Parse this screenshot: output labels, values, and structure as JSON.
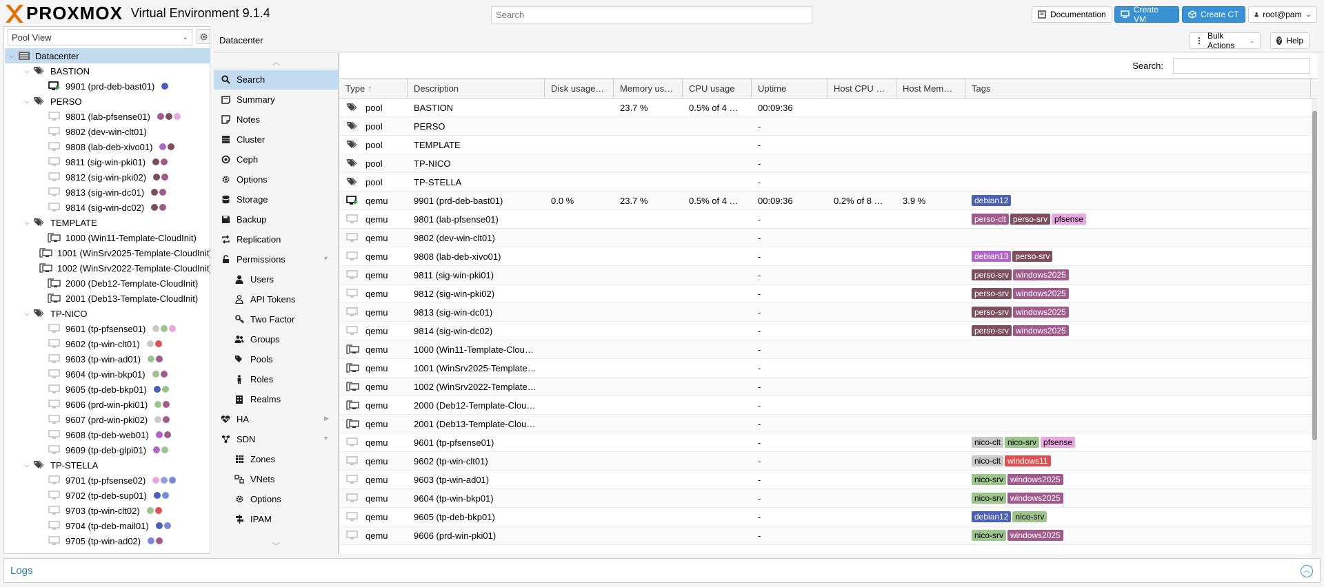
{
  "app": {
    "brand": "PROXMOX",
    "version": "Virtual Environment 9.1.4"
  },
  "header": {
    "search_placeholder": "Search",
    "documentation": "Documentation",
    "create_vm": "Create VM",
    "create_ct": "Create CT",
    "user": "root@pam"
  },
  "left": {
    "view": "Pool View",
    "tree": [
      {
        "level": 0,
        "kind": "datacenter",
        "label": "Datacenter",
        "selected": true,
        "toggle": "open",
        "dots": []
      },
      {
        "level": 1,
        "kind": "pool",
        "label": "BASTION",
        "toggle": "open",
        "dots": []
      },
      {
        "level": 2,
        "kind": "vm-running",
        "label": "9901 (prd-deb-bast01)",
        "dots": [
          "#4a5fb8"
        ]
      },
      {
        "level": 1,
        "kind": "pool",
        "label": "PERSO",
        "toggle": "open",
        "dots": []
      },
      {
        "level": 2,
        "kind": "vm",
        "label": "9801 (lab-pfsense01)",
        "dots": [
          "#a05a8c",
          "#7d4f5e",
          "#e8a8e0"
        ]
      },
      {
        "level": 2,
        "kind": "vm",
        "label": "9802 (dev-win-clt01)",
        "dots": []
      },
      {
        "level": 2,
        "kind": "vm",
        "label": "9808 (lab-deb-xivo01)",
        "dots": [
          "#b065c8",
          "#7d4f5e"
        ]
      },
      {
        "level": 2,
        "kind": "vm",
        "label": "9811 (sig-win-pki01)",
        "dots": [
          "#7d4f5e",
          "#a05a8c"
        ]
      },
      {
        "level": 2,
        "kind": "vm",
        "label": "9812 (sig-win-pki02)",
        "dots": [
          "#7d4f5e",
          "#a05a8c"
        ]
      },
      {
        "level": 2,
        "kind": "vm",
        "label": "9813 (sig-win-dc01)",
        "dots": [
          "#7d4f5e",
          "#a05a8c"
        ]
      },
      {
        "level": 2,
        "kind": "vm",
        "label": "9814 (sig-win-dc02)",
        "dots": [
          "#7d4f5e",
          "#a05a8c"
        ]
      },
      {
        "level": 1,
        "kind": "pool",
        "label": "TEMPLATE",
        "toggle": "open",
        "dots": []
      },
      {
        "level": 2,
        "kind": "template",
        "label": "1000 (Win11-Template-CloudInit)",
        "dots": []
      },
      {
        "level": 2,
        "kind": "template",
        "label": "1001 (WinSrv2025-Template-CloudInit)",
        "dots": []
      },
      {
        "level": 2,
        "kind": "template",
        "label": "1002 (WinSrv2022-Template-CloudInit)",
        "dots": []
      },
      {
        "level": 2,
        "kind": "template",
        "label": "2000 (Deb12-Template-CloudInit)",
        "dots": []
      },
      {
        "level": 2,
        "kind": "template",
        "label": "2001 (Deb13-Template-CloudInit)",
        "dots": []
      },
      {
        "level": 1,
        "kind": "pool",
        "label": "TP-NICO",
        "toggle": "open",
        "dots": []
      },
      {
        "level": 2,
        "kind": "vm",
        "label": "9601 (tp-pfsense01)",
        "dots": [
          "#c9c9c9",
          "#9ec48e",
          "#e8a8e0"
        ]
      },
      {
        "level": 2,
        "kind": "vm",
        "label": "9602 (tp-win-clt01)",
        "dots": [
          "#c9c9c9",
          "#e05050"
        ]
      },
      {
        "level": 2,
        "kind": "vm",
        "label": "9603 (tp-win-ad01)",
        "dots": [
          "#9ec48e",
          "#a05a8c"
        ]
      },
      {
        "level": 2,
        "kind": "vm",
        "label": "9604 (tp-win-bkp01)",
        "dots": [
          "#9ec48e",
          "#a05a8c"
        ]
      },
      {
        "level": 2,
        "kind": "vm",
        "label": "9605 (tp-deb-bkp01)",
        "dots": [
          "#4a5fb8",
          "#9ec48e"
        ]
      },
      {
        "level": 2,
        "kind": "vm",
        "label": "9606 (prd-win-pki01)",
        "dots": [
          "#9ec48e",
          "#a05a8c"
        ]
      },
      {
        "level": 2,
        "kind": "vm",
        "label": "9607 (prd-win-pki02)",
        "dots": [
          "#c9c9c9",
          "#a05a8c"
        ]
      },
      {
        "level": 2,
        "kind": "vm",
        "label": "9608 (tp-deb-web01)",
        "dots": [
          "#b065c8",
          "#a05a8c"
        ]
      },
      {
        "level": 2,
        "kind": "vm",
        "label": "9609 (tp-deb-glpi01)",
        "dots": [
          "#b065c8",
          "#9ec48e"
        ]
      },
      {
        "level": 1,
        "kind": "pool",
        "label": "TP-STELLA",
        "toggle": "open",
        "dots": []
      },
      {
        "level": 2,
        "kind": "vm",
        "label": "9701 (tp-pfsense02)",
        "dots": [
          "#e8a8e0",
          "#9a9ae0",
          "#7a8ad8"
        ]
      },
      {
        "level": 2,
        "kind": "vm",
        "label": "9702 (tp-deb-sup01)",
        "dots": [
          "#4a5fb8",
          "#7a8ad8"
        ]
      },
      {
        "level": 2,
        "kind": "vm",
        "label": "9703 (tp-win-clt02)",
        "dots": [
          "#9ec48e",
          "#e05050"
        ]
      },
      {
        "level": 2,
        "kind": "vm",
        "label": "9704 (tp-deb-mail01)",
        "dots": [
          "#4a5fb8",
          "#7a8ad8"
        ]
      },
      {
        "level": 2,
        "kind": "vm",
        "label": "9705 (tp-win-ad02)",
        "dots": [
          "#7a8ad8",
          "#a05a8c"
        ]
      }
    ]
  },
  "crumb": "Datacenter",
  "actions": {
    "bulk": "Bulk Actions",
    "help": "Help"
  },
  "nav": [
    {
      "label": "Search",
      "icon": "search",
      "level": 0,
      "selected": true
    },
    {
      "label": "Summary",
      "icon": "book",
      "level": 0
    },
    {
      "label": "Notes",
      "icon": "note",
      "level": 0
    },
    {
      "label": "Cluster",
      "icon": "server",
      "level": 0
    },
    {
      "label": "Ceph",
      "icon": "ceph",
      "level": 0
    },
    {
      "label": "Options",
      "icon": "gear",
      "level": 0
    },
    {
      "label": "Storage",
      "icon": "db",
      "level": 0
    },
    {
      "label": "Backup",
      "icon": "floppy",
      "level": 0
    },
    {
      "label": "Replication",
      "icon": "retweet",
      "level": 0
    },
    {
      "label": "Permissions",
      "icon": "unlock",
      "level": 0,
      "expand": true
    },
    {
      "label": "Users",
      "icon": "user",
      "level": 1
    },
    {
      "label": "API Tokens",
      "icon": "user-o",
      "level": 1
    },
    {
      "label": "Two Factor",
      "icon": "key",
      "level": 1
    },
    {
      "label": "Groups",
      "icon": "users",
      "level": 1
    },
    {
      "label": "Pools",
      "icon": "tags",
      "level": 1
    },
    {
      "label": "Roles",
      "icon": "male",
      "level": 1
    },
    {
      "label": "Realms",
      "icon": "building",
      "level": 1
    },
    {
      "label": "HA",
      "icon": "heart",
      "level": 0,
      "expand": "right"
    },
    {
      "label": "SDN",
      "icon": "sdn",
      "level": 0,
      "expand": true
    },
    {
      "label": "Zones",
      "icon": "grid",
      "level": 1
    },
    {
      "label": "VNets",
      "icon": "vnet",
      "level": 1
    },
    {
      "label": "Options",
      "icon": "gear",
      "level": 1
    },
    {
      "label": "IPAM",
      "icon": "ipam",
      "level": 1
    }
  ],
  "grid": {
    "search_label": "Search:",
    "columns": [
      "Type",
      "Description",
      "Disk usage…",
      "Memory us…",
      "CPU usage",
      "Uptime",
      "Host CPU …",
      "Host Mem…",
      "Tags"
    ],
    "rows": [
      {
        "icon": "pool",
        "type": "pool",
        "desc": "BASTION",
        "disk": "",
        "mem": "23.7 %",
        "cpu": "0.5% of 4 …",
        "uptime": "00:09:36",
        "hcpu": "",
        "hmem": "",
        "tags": []
      },
      {
        "icon": "pool",
        "type": "pool",
        "desc": "PERSO",
        "disk": "",
        "mem": "",
        "cpu": "",
        "uptime": "-",
        "hcpu": "",
        "hmem": "",
        "tags": []
      },
      {
        "icon": "pool",
        "type": "pool",
        "desc": "TEMPLATE",
        "disk": "",
        "mem": "",
        "cpu": "",
        "uptime": "-",
        "hcpu": "",
        "hmem": "",
        "tags": []
      },
      {
        "icon": "pool",
        "type": "pool",
        "desc": "TP-NICO",
        "disk": "",
        "mem": "",
        "cpu": "",
        "uptime": "-",
        "hcpu": "",
        "hmem": "",
        "tags": []
      },
      {
        "icon": "pool",
        "type": "pool",
        "desc": "TP-STELLA",
        "disk": "",
        "mem": "",
        "cpu": "",
        "uptime": "-",
        "hcpu": "",
        "hmem": "",
        "tags": []
      },
      {
        "icon": "vm-running",
        "type": "qemu",
        "desc": "9901 (prd-deb-bast01)",
        "disk": "0.0 %",
        "mem": "23.7 %",
        "cpu": "0.5% of 4 …",
        "uptime": "00:09:36",
        "hcpu": "0.2% of 8 …",
        "hmem": "3.9 %",
        "tags": [
          "debian12"
        ]
      },
      {
        "icon": "vm",
        "type": "qemu",
        "desc": "9801 (lab-pfsense01)",
        "disk": "",
        "mem": "",
        "cpu": "",
        "uptime": "-",
        "hcpu": "",
        "hmem": "",
        "tags": [
          "perso-clt",
          "perso-srv",
          "pfsense"
        ]
      },
      {
        "icon": "vm",
        "type": "qemu",
        "desc": "9802 (dev-win-clt01)",
        "disk": "",
        "mem": "",
        "cpu": "",
        "uptime": "-",
        "hcpu": "",
        "hmem": "",
        "tags": []
      },
      {
        "icon": "vm",
        "type": "qemu",
        "desc": "9808 (lab-deb-xivo01)",
        "disk": "",
        "mem": "",
        "cpu": "",
        "uptime": "-",
        "hcpu": "",
        "hmem": "",
        "tags": [
          "debian13",
          "perso-srv"
        ]
      },
      {
        "icon": "vm",
        "type": "qemu",
        "desc": "9811 (sig-win-pki01)",
        "disk": "",
        "mem": "",
        "cpu": "",
        "uptime": "-",
        "hcpu": "",
        "hmem": "",
        "tags": [
          "perso-srv",
          "windows2025"
        ]
      },
      {
        "icon": "vm",
        "type": "qemu",
        "desc": "9812 (sig-win-pki02)",
        "disk": "",
        "mem": "",
        "cpu": "",
        "uptime": "-",
        "hcpu": "",
        "hmem": "",
        "tags": [
          "perso-srv",
          "windows2025"
        ]
      },
      {
        "icon": "vm",
        "type": "qemu",
        "desc": "9813 (sig-win-dc01)",
        "disk": "",
        "mem": "",
        "cpu": "",
        "uptime": "-",
        "hcpu": "",
        "hmem": "",
        "tags": [
          "perso-srv",
          "windows2025"
        ]
      },
      {
        "icon": "vm",
        "type": "qemu",
        "desc": "9814 (sig-win-dc02)",
        "disk": "",
        "mem": "",
        "cpu": "",
        "uptime": "-",
        "hcpu": "",
        "hmem": "",
        "tags": [
          "perso-srv",
          "windows2025"
        ]
      },
      {
        "icon": "template",
        "type": "qemu",
        "desc": "1000 (Win11-Template-Clou…",
        "disk": "",
        "mem": "",
        "cpu": "",
        "uptime": "-",
        "hcpu": "",
        "hmem": "",
        "tags": []
      },
      {
        "icon": "template",
        "type": "qemu",
        "desc": "1001 (WinSrv2025-Template…",
        "disk": "",
        "mem": "",
        "cpu": "",
        "uptime": "-",
        "hcpu": "",
        "hmem": "",
        "tags": []
      },
      {
        "icon": "template",
        "type": "qemu",
        "desc": "1002 (WinSrv2022-Template…",
        "disk": "",
        "mem": "",
        "cpu": "",
        "uptime": "-",
        "hcpu": "",
        "hmem": "",
        "tags": []
      },
      {
        "icon": "template",
        "type": "qemu",
        "desc": "2000 (Deb12-Template-Clou…",
        "disk": "",
        "mem": "",
        "cpu": "",
        "uptime": "-",
        "hcpu": "",
        "hmem": "",
        "tags": []
      },
      {
        "icon": "template",
        "type": "qemu",
        "desc": "2001 (Deb13-Template-Clou…",
        "disk": "",
        "mem": "",
        "cpu": "",
        "uptime": "-",
        "hcpu": "",
        "hmem": "",
        "tags": []
      },
      {
        "icon": "vm",
        "type": "qemu",
        "desc": "9601 (tp-pfsense01)",
        "disk": "",
        "mem": "",
        "cpu": "",
        "uptime": "-",
        "hcpu": "",
        "hmem": "",
        "tags": [
          "nico-clt",
          "nico-srv",
          "pfsense"
        ]
      },
      {
        "icon": "vm",
        "type": "qemu",
        "desc": "9602 (tp-win-clt01)",
        "disk": "",
        "mem": "",
        "cpu": "",
        "uptime": "-",
        "hcpu": "",
        "hmem": "",
        "tags": [
          "nico-clt",
          "windows11"
        ]
      },
      {
        "icon": "vm",
        "type": "qemu",
        "desc": "9603 (tp-win-ad01)",
        "disk": "",
        "mem": "",
        "cpu": "",
        "uptime": "-",
        "hcpu": "",
        "hmem": "",
        "tags": [
          "nico-srv",
          "windows2025"
        ]
      },
      {
        "icon": "vm",
        "type": "qemu",
        "desc": "9604 (tp-win-bkp01)",
        "disk": "",
        "mem": "",
        "cpu": "",
        "uptime": "-",
        "hcpu": "",
        "hmem": "",
        "tags": [
          "nico-srv",
          "windows2025"
        ]
      },
      {
        "icon": "vm",
        "type": "qemu",
        "desc": "9605 (tp-deb-bkp01)",
        "disk": "",
        "mem": "",
        "cpu": "",
        "uptime": "-",
        "hcpu": "",
        "hmem": "",
        "tags": [
          "debian12",
          "nico-srv"
        ]
      },
      {
        "icon": "vm",
        "type": "qemu",
        "desc": "9606 (prd-win-pki01)",
        "disk": "",
        "mem": "",
        "cpu": "",
        "uptime": "-",
        "hcpu": "",
        "hmem": "",
        "tags": [
          "nico-srv",
          "windows2025"
        ]
      }
    ]
  },
  "tag_colors": {
    "debian12": {
      "bg": "#4a5fb8",
      "fg": "#ffffff"
    },
    "debian13": {
      "bg": "#b065c8",
      "fg": "#ffffff"
    },
    "perso-clt": {
      "bg": "#a05a8c",
      "fg": "#ffffff"
    },
    "perso-srv": {
      "bg": "#7d4f5e",
      "fg": "#ffffff"
    },
    "pfsense": {
      "bg": "#e8a8e0",
      "fg": "#000000"
    },
    "windows2025": {
      "bg": "#a05a8c",
      "fg": "#ffffff"
    },
    "windows11": {
      "bg": "#e05050",
      "fg": "#ffffff"
    },
    "nico-clt": {
      "bg": "#c9c9c9",
      "fg": "#000000"
    },
    "nico-srv": {
      "bg": "#9ec48e",
      "fg": "#000000"
    }
  },
  "logs": {
    "title": "Logs"
  },
  "colors": {
    "accent": "#3892d4",
    "selection": "#c3dbf0",
    "running": "#2ea043"
  }
}
